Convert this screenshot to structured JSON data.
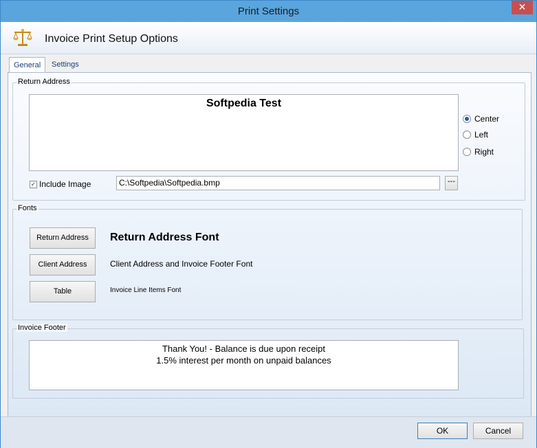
{
  "window": {
    "title": "Print Settings",
    "close_glyph": "✕"
  },
  "header": {
    "title": "Invoice Print Setup Options",
    "icon": "scales-icon"
  },
  "tabs": [
    {
      "label": "General",
      "active": true
    },
    {
      "label": "Settings",
      "active": false
    }
  ],
  "return_address": {
    "group_label": "Return Address",
    "text": "Softpedia Test",
    "alignment_options": [
      {
        "label": "Center",
        "selected": true
      },
      {
        "label": "Left",
        "selected": false
      },
      {
        "label": "Right",
        "selected": false
      }
    ],
    "include_image": {
      "label": "Include Image",
      "checked": true,
      "check_glyph": "✓"
    },
    "image_path": "C:\\Softpedia\\Softpedia.bmp",
    "browse_label": "---"
  },
  "fonts": {
    "group_label": "Fonts",
    "items": [
      {
        "button_label": "Return Address",
        "sample_text": "Return Address Font"
      },
      {
        "button_label": "Client Address",
        "sample_text": "Client Address and Invoice Footer Font"
      },
      {
        "button_label": "Table",
        "sample_text": "Invoice Line Items Font"
      }
    ]
  },
  "invoice_footer": {
    "group_label": "Invoice Footer",
    "lines": [
      "Thank You! - Balance is due upon receipt",
      "1.5% interest per month on unpaid balances"
    ]
  },
  "buttons": {
    "ok": "OK",
    "cancel": "Cancel"
  },
  "colors": {
    "title_bar": "#5aa5dd",
    "close_button": "#c74f4f",
    "accent": "#1a3d78"
  }
}
